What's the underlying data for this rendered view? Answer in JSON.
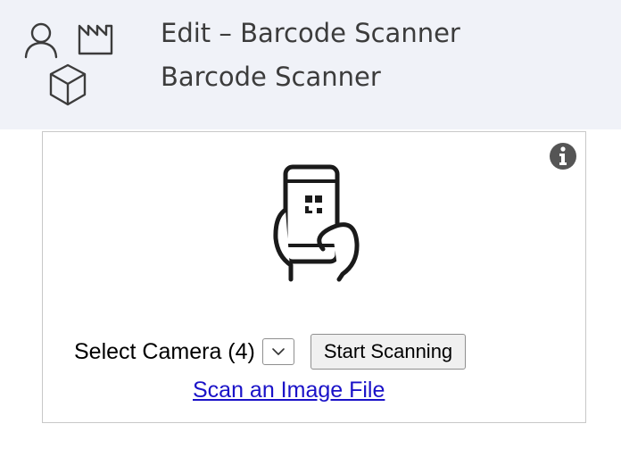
{
  "header": {
    "title": "Edit – Barcode Scanner",
    "subtitle": "Barcode Scanner",
    "icons": [
      "user-icon",
      "factory-icon",
      "cube-icon"
    ]
  },
  "scanner": {
    "illustration_icon": "phone-qr-scan-icon",
    "info_icon": "info-icon",
    "camera_label": "Select Camera (4)",
    "camera_dropdown_icon": "chevron-down-icon",
    "start_button_label": "Start Scanning",
    "scan_file_link": "Scan an Image File"
  },
  "colors": {
    "header_background": "#f0f2f8",
    "header_text": "#3c3c3c",
    "panel_border": "#c8c8c8",
    "link": "#1a12c8",
    "info_icon": "#555555"
  }
}
